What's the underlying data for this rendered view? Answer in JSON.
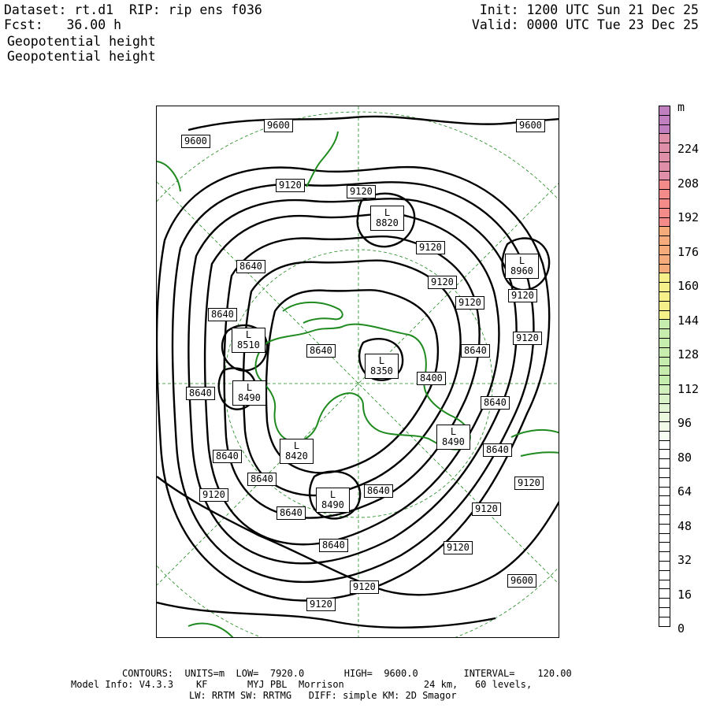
{
  "header": {
    "dataset_line": "Dataset: rt.d1  RIP: rip ens f036",
    "fcst_line": "Fcst:   36.00 h",
    "init_line": "Init: 1200 UTC Sun 21 Dec 25",
    "valid_line": "Valid: 0000 UTC Tue 23 Dec 25",
    "field_1": "Geopotential height",
    "field_2": "Geopotential height"
  },
  "colorbar": {
    "unit": "m",
    "tick_labels": [
      "224",
      "208",
      "192",
      "176",
      "160",
      "144",
      "128",
      "112",
      "96",
      "80",
      "64",
      "48",
      "32",
      "16",
      "0"
    ],
    "colors": {
      "top": "#c080c0",
      "pink": "#e08fa8",
      "red": "#f38b8b",
      "orange": "#f5ab7a",
      "yellow": "#f5f08a",
      "green": "#c6ecae",
      "white": "#ffffff"
    }
  },
  "contour_labels": [
    {
      "id": "c1",
      "text": "9600"
    },
    {
      "id": "c2",
      "text": "9600"
    },
    {
      "id": "c3",
      "text": "9600"
    },
    {
      "id": "c4",
      "text": "9600"
    },
    {
      "id": "c5",
      "text": "9120"
    },
    {
      "id": "c6",
      "text": "9120"
    },
    {
      "id": "c7",
      "text": "9120"
    },
    {
      "id": "c8",
      "text": "9120"
    },
    {
      "id": "c9",
      "text": "9120"
    },
    {
      "id": "c10",
      "text": "9120"
    },
    {
      "id": "c11",
      "text": "9120"
    },
    {
      "id": "c12",
      "text": "9120"
    },
    {
      "id": "c13",
      "text": "9120"
    },
    {
      "id": "c14",
      "text": "9120"
    },
    {
      "id": "c15",
      "text": "9120"
    },
    {
      "id": "c16",
      "text": "9120"
    },
    {
      "id": "c17",
      "text": "9120"
    },
    {
      "id": "c18",
      "text": "8640"
    },
    {
      "id": "c19",
      "text": "8640"
    },
    {
      "id": "c20",
      "text": "8640"
    },
    {
      "id": "c21",
      "text": "8640"
    },
    {
      "id": "c22",
      "text": "8640"
    },
    {
      "id": "c23",
      "text": "8640"
    },
    {
      "id": "c24",
      "text": "8640"
    },
    {
      "id": "c25",
      "text": "8640"
    },
    {
      "id": "c26",
      "text": "8640"
    },
    {
      "id": "c27",
      "text": "8640"
    },
    {
      "id": "c28",
      "text": "8640"
    },
    {
      "id": "c29",
      "text": "8640"
    },
    {
      "id": "c30",
      "text": "8400"
    }
  ],
  "lows": [
    {
      "id": "l1",
      "mark": "L",
      "value": "8820"
    },
    {
      "id": "l2",
      "mark": "L",
      "value": "8960"
    },
    {
      "id": "l3",
      "mark": "L",
      "value": "8510"
    },
    {
      "id": "l4",
      "mark": "L",
      "value": "8350"
    },
    {
      "id": "l5",
      "mark": "L",
      "value": "8490"
    },
    {
      "id": "l6",
      "mark": "L",
      "value": "8420"
    },
    {
      "id": "l7",
      "mark": "L",
      "value": "8490"
    },
    {
      "id": "l8",
      "mark": "L",
      "value": "8490"
    }
  ],
  "colors": {
    "contour": "#000000",
    "coast": "#1f8a1f",
    "grid": "#1f8a1f"
  },
  "footer": {
    "line1": "CONTOURS:  UNITS=m  LOW=  7920.0       HIGH=  9600.0        INTERVAL=    120.00",
    "line2": "Model Info: V4.3.3    KF       MYJ PBL  Morrison              24 km,   60 levels,",
    "line3": "LW: RRTM SW: RRTMG   DIFF: simple KM: 2D Smagor"
  }
}
